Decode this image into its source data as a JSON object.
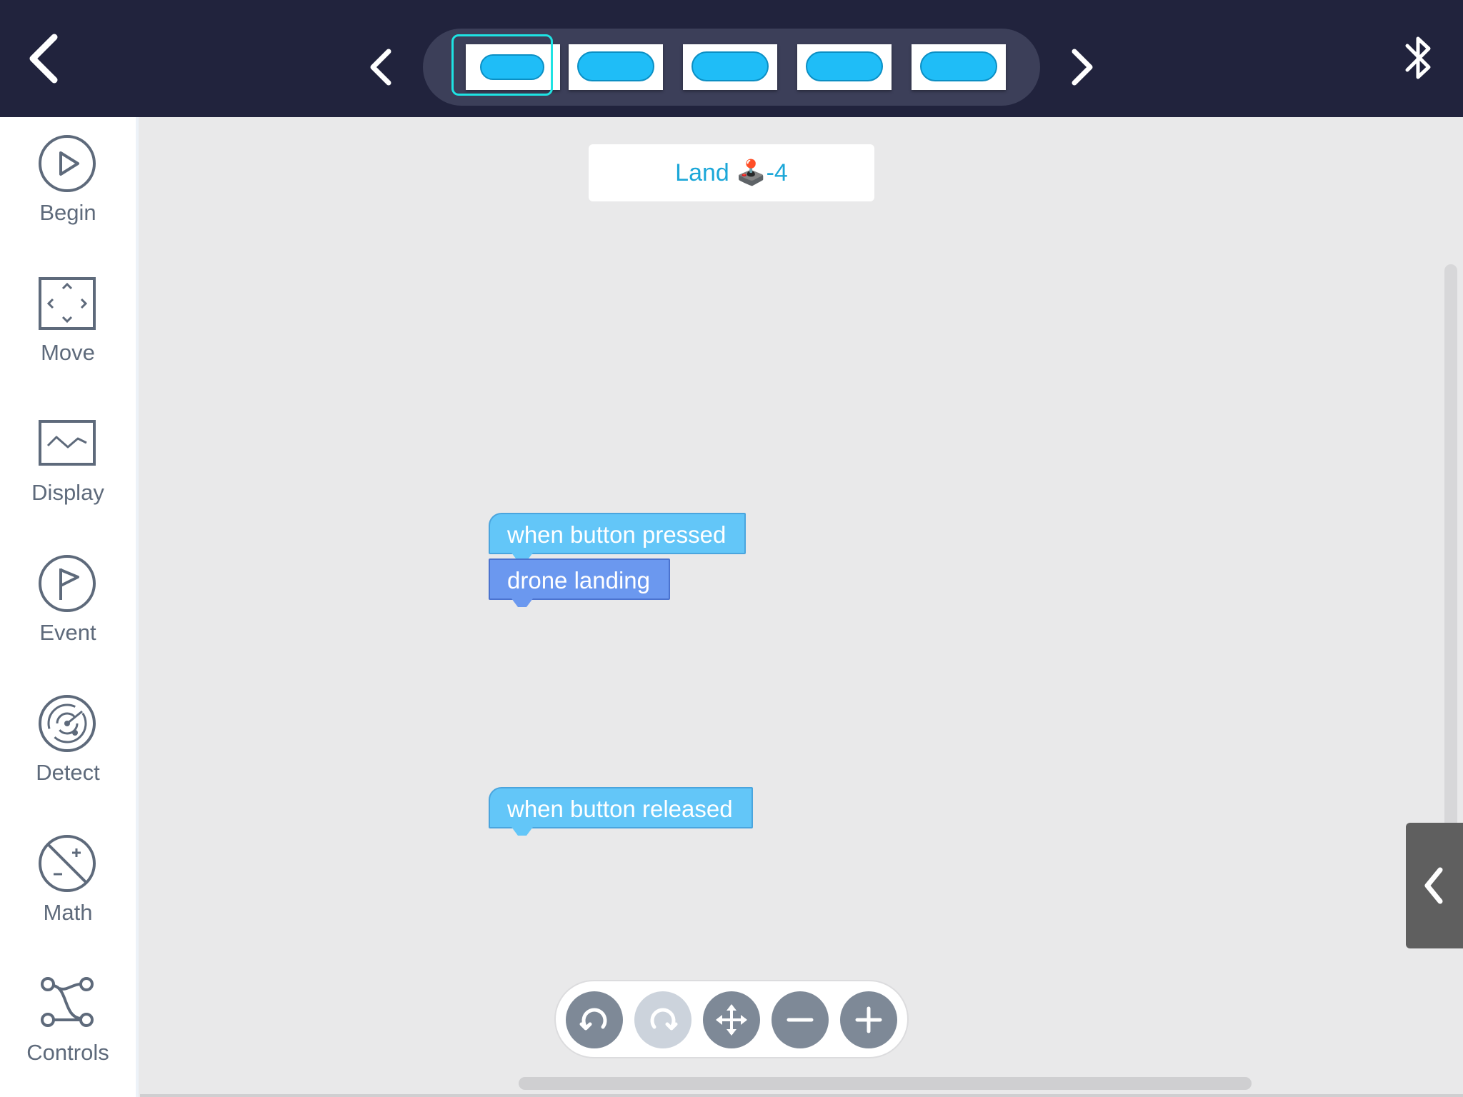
{
  "header": {
    "slots": [
      {
        "id": 1,
        "selected": true
      },
      {
        "id": 2,
        "selected": false
      },
      {
        "id": 3,
        "selected": false
      },
      {
        "id": 4,
        "selected": false
      },
      {
        "id": 5,
        "selected": false
      }
    ],
    "slot_color": "#1fbdf7",
    "selection_color": "#1ee3e3"
  },
  "sidebar": {
    "items": [
      {
        "label": "Begin",
        "icon": "play-icon"
      },
      {
        "label": "Move",
        "icon": "move-icon"
      },
      {
        "label": "Display",
        "icon": "display-icon"
      },
      {
        "label": "Event",
        "icon": "flag-icon"
      },
      {
        "label": "Detect",
        "icon": "radar-icon"
      },
      {
        "label": "Math",
        "icon": "math-icon"
      },
      {
        "label": "Controls",
        "icon": "controls-icon"
      }
    ]
  },
  "canvas": {
    "title_text": "Land ",
    "title_emoji": "🕹️",
    "title_suffix": "-4",
    "blocks": {
      "pressed": "when button pressed",
      "landing": "drone landing",
      "released": "when button released"
    }
  },
  "toolbar": {
    "buttons": [
      "undo-icon",
      "redo-icon",
      "move-canvas-icon",
      "zoom-out-icon",
      "zoom-in-icon"
    ],
    "redo_enabled": false
  },
  "colors": {
    "topbar": "#21233d",
    "event_block": "#63c6f8",
    "action_block": "#6b98ef",
    "accent_text": "#1ca7d8"
  }
}
